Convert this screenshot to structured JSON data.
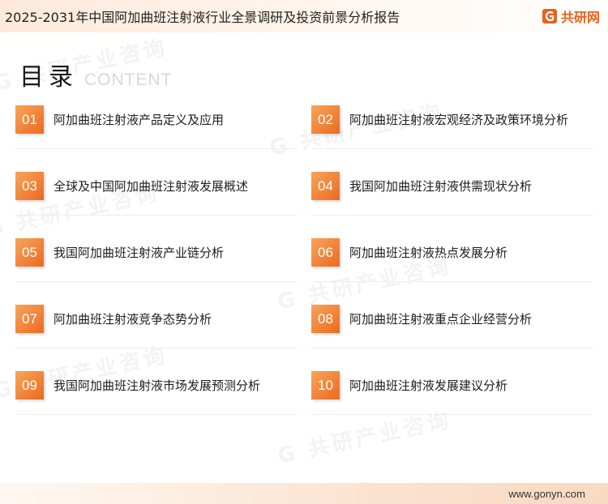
{
  "header": {
    "doc_title": "2025-2031年中国阿加曲班注射液行业全景调研及投资前景分析报告",
    "logo_text": "共研网"
  },
  "heading": {
    "cn": "目录",
    "en": "CONTENT"
  },
  "toc": [
    {
      "num": "01",
      "label": "阿加曲班注射液产品定义及应用"
    },
    {
      "num": "02",
      "label": "阿加曲班注射液宏观经济及政策环境分析"
    },
    {
      "num": "03",
      "label": "全球及中国阿加曲班注射液发展概述"
    },
    {
      "num": "04",
      "label": "我国阿加曲班注射液供需现状分析"
    },
    {
      "num": "05",
      "label": "我国阿加曲班注射液产业链分析"
    },
    {
      "num": "06",
      "label": "阿加曲班注射液热点发展分析"
    },
    {
      "num": "07",
      "label": "阿加曲班注射液竞争态势分析"
    },
    {
      "num": "08",
      "label": "阿加曲班注射液重点企业经营分析"
    },
    {
      "num": "09",
      "label": "我国阿加曲班注射液市场发展预测分析"
    },
    {
      "num": "10",
      "label": "阿加曲班注射液发展建议分析"
    }
  ],
  "footer": {
    "url": "www.gonyn.com"
  },
  "colors": {
    "accent": "#ec6a1f",
    "accent_light": "#f7a55c"
  }
}
